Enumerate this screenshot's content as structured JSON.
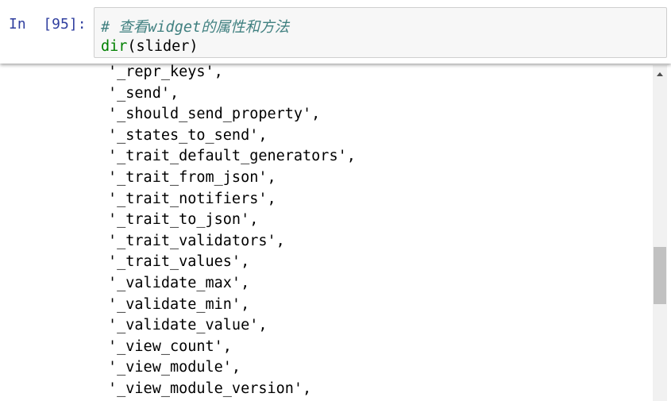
{
  "input_cell": {
    "prompt": "In  [95]:",
    "comment": "# 查看widget的属性和方法",
    "code_builtin": "dir",
    "code_rest": "(slider)"
  },
  "output": {
    "lines": [
      "'_repr_keys',",
      "'_send',",
      "'_should_send_property',",
      "'_states_to_send',",
      "'_trait_default_generators',",
      "'_trait_from_json',",
      "'_trait_notifiers',",
      "'_trait_to_json',",
      "'_trait_validators',",
      "'_trait_values',",
      "'_validate_max',",
      "'_validate_min',",
      "'_validate_value',",
      "'_view_count',",
      "'_view_module',",
      "'_view_module_version',"
    ]
  },
  "scrollbar": {
    "position_fraction": 0.55
  }
}
